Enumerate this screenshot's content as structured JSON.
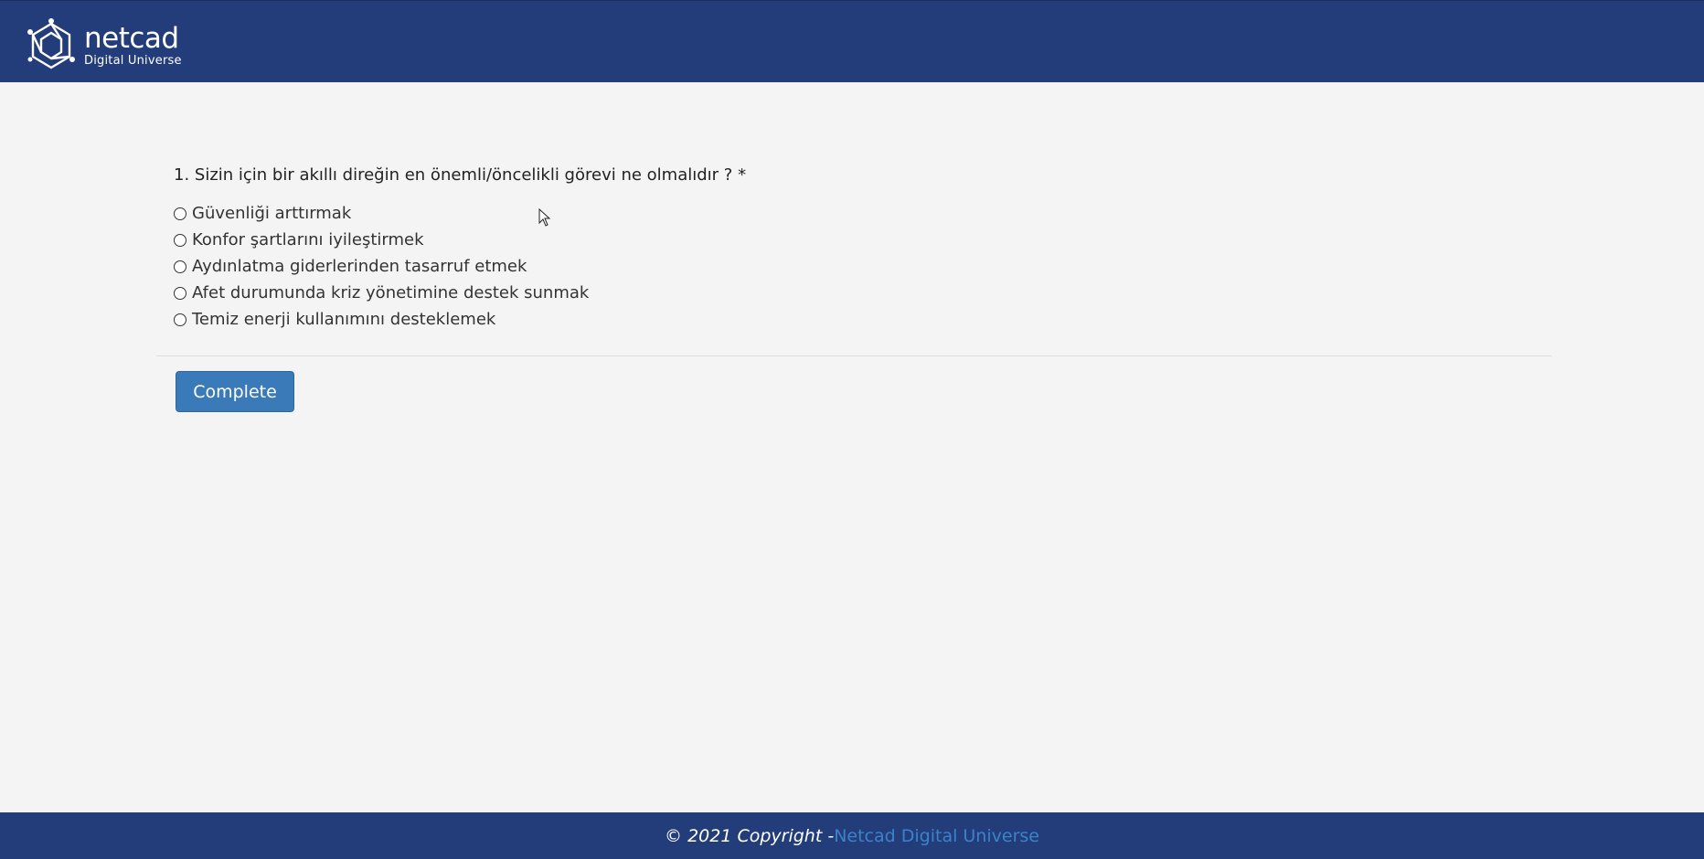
{
  "header": {
    "logo_icon": "netcad-hexagon-logo-icon",
    "logo_name": "netcad",
    "logo_sub": "Digital Universe",
    "background": "#233d7b"
  },
  "survey": {
    "question": "1. Sizin için bir akıllı direğin en önemli/öncelikli görevi ne olmalıdır ? *",
    "options": [
      "Güvenliği arttırmak",
      "Konfor şartlarını iyileştirmek",
      "Aydınlatma giderlerinden tasarruf etmek",
      "Afet durumunda kriz yönetimine destek sunmak",
      "Temiz enerji kullanımını desteklemek"
    ],
    "complete_label": "Complete",
    "button_color": "#3a7ab8"
  },
  "footer": {
    "copyright": "© 2021 Copyright -",
    "link_text": "Netcad Digital Universe",
    "link_color": "#3b83c9"
  }
}
